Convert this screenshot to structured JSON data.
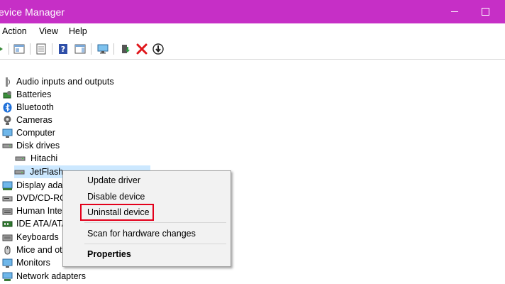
{
  "window": {
    "title": "evice Manager"
  },
  "menu": {
    "items": [
      "Action",
      "View",
      "Help"
    ]
  },
  "toolbar": {
    "icons": [
      "forward-icon",
      "properties-icon",
      "computer-management-icon",
      "help-icon",
      "action-pane-icon",
      "monitor-icon",
      "enable-device-icon",
      "uninstall-icon",
      "update-driver-icon"
    ]
  },
  "tree": {
    "categories": [
      "Audio inputs and outputs",
      "Batteries",
      "Bluetooth",
      "Cameras",
      "Computer",
      "Disk drives",
      "Display adap",
      "DVD/CD-RO",
      "Human Inte",
      "IDE ATA/ATA",
      "Keyboards",
      "Mice and ot",
      "Monitors",
      "Network adapters"
    ],
    "disk_children": [
      "Hitachi",
      "JetFlash"
    ],
    "selected": "JetFlash"
  },
  "context_menu": {
    "update_driver": "Update driver",
    "disable_device": "Disable device",
    "uninstall_device": "Uninstall device",
    "scan": "Scan for hardware changes",
    "properties": "Properties"
  },
  "colors": {
    "titlebar": "#c62fc6",
    "selection": "#cce8ff",
    "highlight": "#e3001b"
  }
}
